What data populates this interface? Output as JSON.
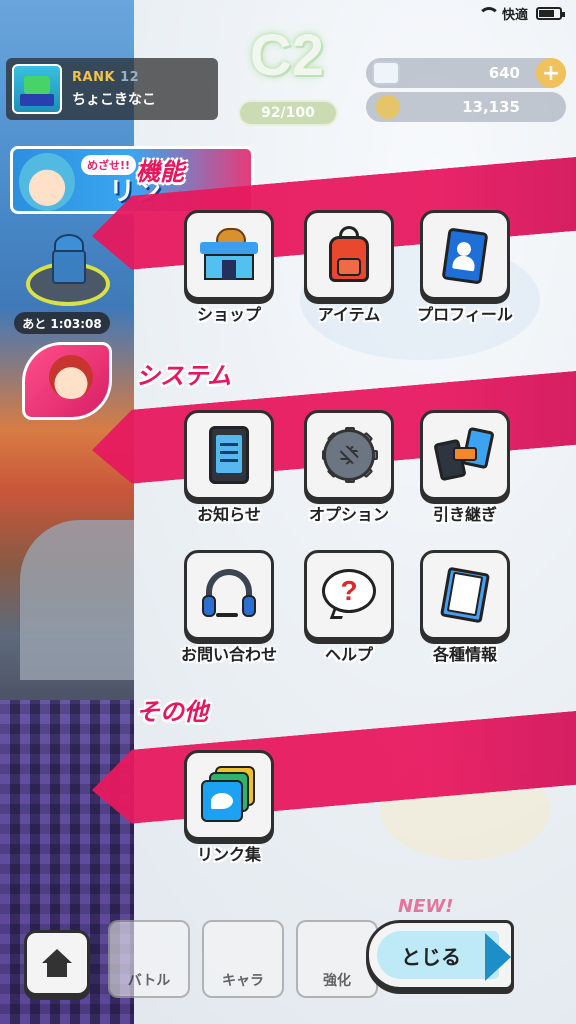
{
  "status_bar": {
    "network": "快適"
  },
  "player": {
    "rank_label": "RANK",
    "rank_value": "12",
    "name": "ちょこきなこ"
  },
  "grade": {
    "label": "C2",
    "progress_text": "92/100",
    "progress": 0.92
  },
  "currencies": {
    "gems": "640",
    "coins": "13,135",
    "add_label": "+"
  },
  "event_banner": {
    "tag": "めざせ!!",
    "title": "リン"
  },
  "side": {
    "timer": "あと 1:03:08"
  },
  "sections": [
    {
      "title": "機能",
      "items": [
        {
          "label": "ショップ",
          "icon": "shop-icon"
        },
        {
          "label": "アイテム",
          "icon": "backpack-icon"
        },
        {
          "label": "プロフィール",
          "icon": "profile-card-icon"
        }
      ]
    },
    {
      "title": "システム",
      "items": [
        {
          "label": "お知らせ",
          "icon": "notice-icon"
        },
        {
          "label": "オプション",
          "icon": "gear-icon"
        },
        {
          "label": "引き継ぎ",
          "icon": "transfer-icon"
        },
        {
          "label": "お問い合わせ",
          "icon": "headset-icon"
        },
        {
          "label": "ヘルプ",
          "icon": "help-icon"
        },
        {
          "label": "各種情報",
          "icon": "notebook-icon"
        }
      ]
    },
    {
      "title": "その他",
      "items": [
        {
          "label": "リンク集",
          "icon": "twitter-icon"
        }
      ]
    }
  ],
  "bottom_nav": {
    "battle": "バトル",
    "chara": "キャラ",
    "enhance": "強化",
    "new_tag": "NEW!",
    "close": "とじる"
  },
  "colors": {
    "accent_pink": "#e8165c",
    "close_blue": "#1d8fc8"
  }
}
